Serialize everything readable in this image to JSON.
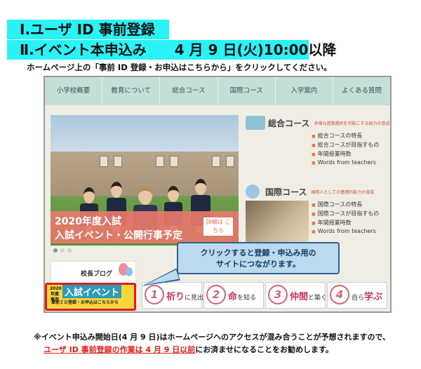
{
  "steps": {
    "step1": "Ⅰ.ユーザ ID 事前登録",
    "step2": "Ⅱ.イベント本申込み　　4 月 9 日(火)10:00以降"
  },
  "instruction": "ホームページ上の「事前 ID 登録・お申込はこちらから」をクリックしてください。",
  "website": {
    "nav": [
      "小学校概要",
      "教育について",
      "総合コース",
      "国際コース",
      "入学案内",
      "よくある質問"
    ],
    "banner": {
      "line1": "2020年度入試",
      "line2": "入試イベント・公開行事予定",
      "button": "詳細は こちら"
    },
    "sogo": {
      "title": "総合コース",
      "subtitle": "多様な進路選択を可能にする総力の育成",
      "links": [
        "総合コースの特長",
        "総合コースが目指すもの",
        "年間授業時数",
        "Words from teachers"
      ]
    },
    "kokusai": {
      "title": "国際コース",
      "subtitle": "国際人としての基礎的能力の育成",
      "links": [
        "国際コースの特長",
        "国際コースが目指すもの",
        "年間授業時数",
        "Words from teachers"
      ]
    },
    "blog_title": "校長ブログ",
    "event_button": {
      "small": "2020 年度 専用",
      "big": "入試イベント",
      "sub": "事前ＩＤ登録・お申込はこちらから"
    },
    "virtues": [
      {
        "num": "1",
        "big": "祈り",
        "small": "に見出す"
      },
      {
        "num": "2",
        "big": "命",
        "small": "を知る"
      },
      {
        "num": "3",
        "big": "仲間",
        "small": "と築く"
      },
      {
        "num": "4",
        "big": "学ぶ",
        "small": "自ら"
      }
    ]
  },
  "callout": {
    "line1": "クリックすると登録・申込み用の",
    "line2": "サイトにつながります。"
  },
  "note": {
    "line1": "※イベント申込み開始日(4 月 9 日)はホームページへのアクセスが混み合うことが予想されますので、",
    "line2_red": "ユーザ ID 事前登録の作業は 4 月 9 日以前",
    "line2_rest": "にお済ませになることをお勧めします。"
  }
}
